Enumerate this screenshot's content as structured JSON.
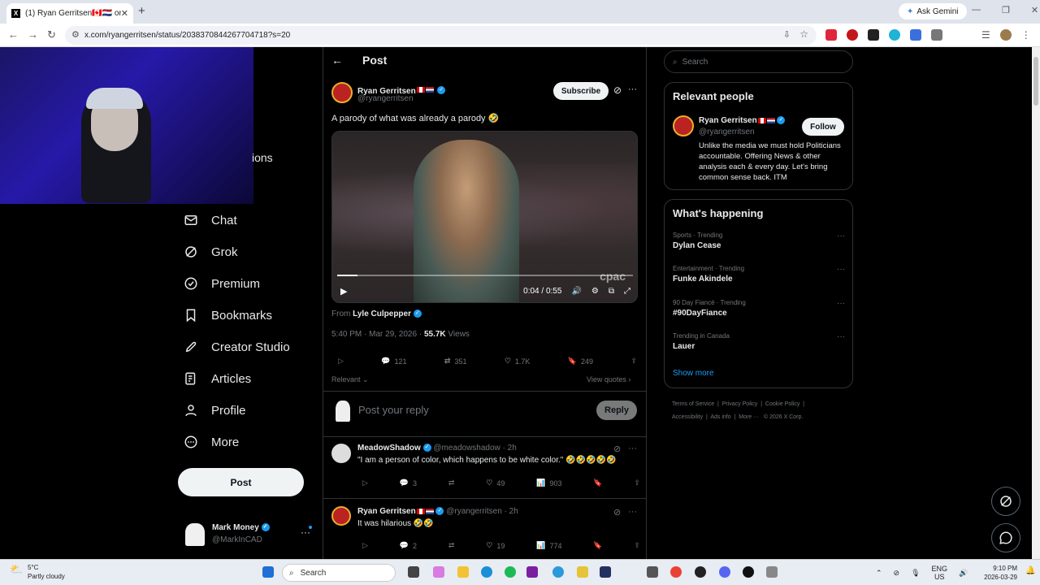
{
  "browser": {
    "tab_title": "(1) Ryan Gerritsen🇨🇦🇳🇱 on X: \"A",
    "url": "x.com/ryangerritsen/status/2038370844267704718?s=20",
    "ask_gemini": "Ask Gemini"
  },
  "sidebar": {
    "partial_item": "ions",
    "items": [
      {
        "label": "Chat",
        "icon": "mail-icon"
      },
      {
        "label": "Grok",
        "icon": "grok-icon"
      },
      {
        "label": "Premium",
        "icon": "premium-icon"
      },
      {
        "label": "Bookmarks",
        "icon": "bookmark-icon"
      },
      {
        "label": "Creator Studio",
        "icon": "rocket-icon"
      },
      {
        "label": "Articles",
        "icon": "article-icon"
      },
      {
        "label": "Profile",
        "icon": "person-icon"
      },
      {
        "label": "More",
        "icon": "more-circle-icon"
      }
    ],
    "post_button": "Post",
    "account": {
      "name": "Mark Money",
      "handle": "@MarkInCAD"
    }
  },
  "post": {
    "header_title": "Post",
    "author_name": "Ryan Gerritsen",
    "author_handle": "@ryangerritsen",
    "subscribe": "Subscribe",
    "text": "A parody of what was already a parody 🤣",
    "video": {
      "current": "0:04",
      "separator": "/",
      "duration": "0:55",
      "progress": 0.07,
      "watermark": "cpac"
    },
    "from_label": "From",
    "from_name": "Lyle Culpepper",
    "timestamp": "5:40 PM · Mar 29, 2026 ·",
    "views_count": "55.7K",
    "views_label": "Views",
    "stats": {
      "replies": "121",
      "reposts": "351",
      "likes": "1.7K",
      "bookmarks": "249"
    },
    "sort_label": "Relevant",
    "view_quotes": "View quotes",
    "reply_placeholder": "Post your reply",
    "reply_button": "Reply"
  },
  "replies": [
    {
      "name": "MeadowShadow",
      "handle": "@meadowshadow · 2h",
      "text": "\"I am a person of color, which happens to be white color.\" 🤣🤣🤣🤣🤣",
      "replies": "3",
      "likes": "49",
      "views": "903"
    },
    {
      "name": "Ryan Gerritsen",
      "handle": "@ryangerritsen · 2h",
      "text": "It was hilarious 🤣🤣",
      "replies": "2",
      "likes": "19",
      "views": "774"
    }
  ],
  "right": {
    "search_placeholder": "Search",
    "relevant_title": "Relevant people",
    "person": {
      "name": "Ryan Gerritsen",
      "handle": "@ryangerritsen",
      "bio": "Unlike the media we must hold Politicians accountable. Offering News & other analysis each & every day. Let's bring common sense back. ITM",
      "follow": "Follow"
    },
    "happening_title": "What's happening",
    "trends": [
      {
        "context": "Sports · Trending",
        "name": "Dylan Cease"
      },
      {
        "context": "Entertainment · Trending",
        "name": "Funke Akindele"
      },
      {
        "context": "90 Day Fiancé · Trending",
        "name": "#90DayFiance"
      },
      {
        "context": "Trending in Canada",
        "name": "Lauer"
      }
    ],
    "show_more": "Show more",
    "footer": [
      "Terms of Service",
      "Privacy Policy",
      "Cookie Policy",
      "Accessibility",
      "Ads info",
      "More ···",
      "© 2026 X Corp."
    ]
  },
  "taskbar": {
    "temp": "5°C",
    "weather": "Partly cloudy",
    "search": "Search",
    "lang1": "ENG",
    "lang2": "US",
    "time": "9:10 PM",
    "date": "2026-03-29"
  },
  "colors": {
    "accent": "#1d9bf0",
    "background": "#000000",
    "border": "#2f3336",
    "muted": "#71767b"
  }
}
